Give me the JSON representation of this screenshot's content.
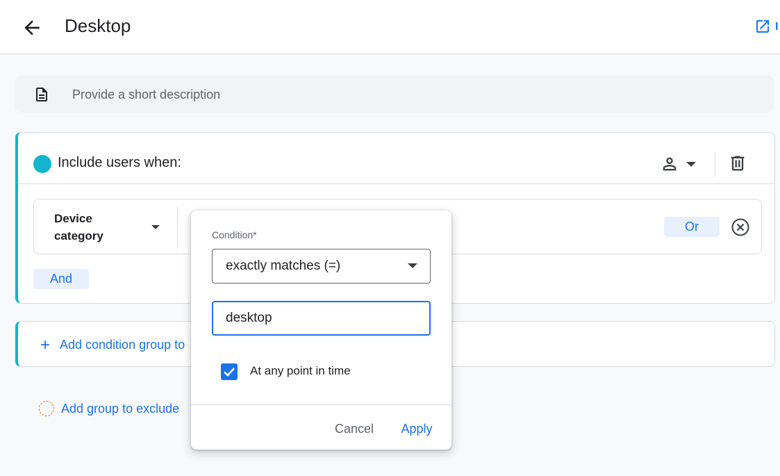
{
  "header": {
    "title": "Desktop",
    "back_icon": "arrow-back-icon",
    "open_icon": "open-in-new-icon",
    "open_label_fragment": "I"
  },
  "description": {
    "placeholder": "Provide a short description",
    "icon": "document-icon"
  },
  "include_group": {
    "title": "Include users when:",
    "accent_color": "#12b5cb",
    "scope_icon": "person-icon",
    "delete_icon": "trash-icon",
    "condition": {
      "dimension": "Device category",
      "or_label": "Or",
      "remove_icon": "close-circle-icon"
    },
    "and_label": "And"
  },
  "add_condition_group": {
    "label": "Add condition group to"
  },
  "exclude": {
    "label": "Add group to exclude"
  },
  "popup": {
    "condition_label": "Condition*",
    "condition_value": "exactly matches (=)",
    "input_value": "desktop",
    "checkbox_label": "At any point in time",
    "checkbox_checked": true,
    "cancel_label": "Cancel",
    "apply_label": "Apply"
  },
  "colors": {
    "accent_blue": "#1a73e8",
    "teal": "#12b5cb",
    "chip_bg": "#e8f0fe",
    "exclude_orange": "#e8710a"
  }
}
